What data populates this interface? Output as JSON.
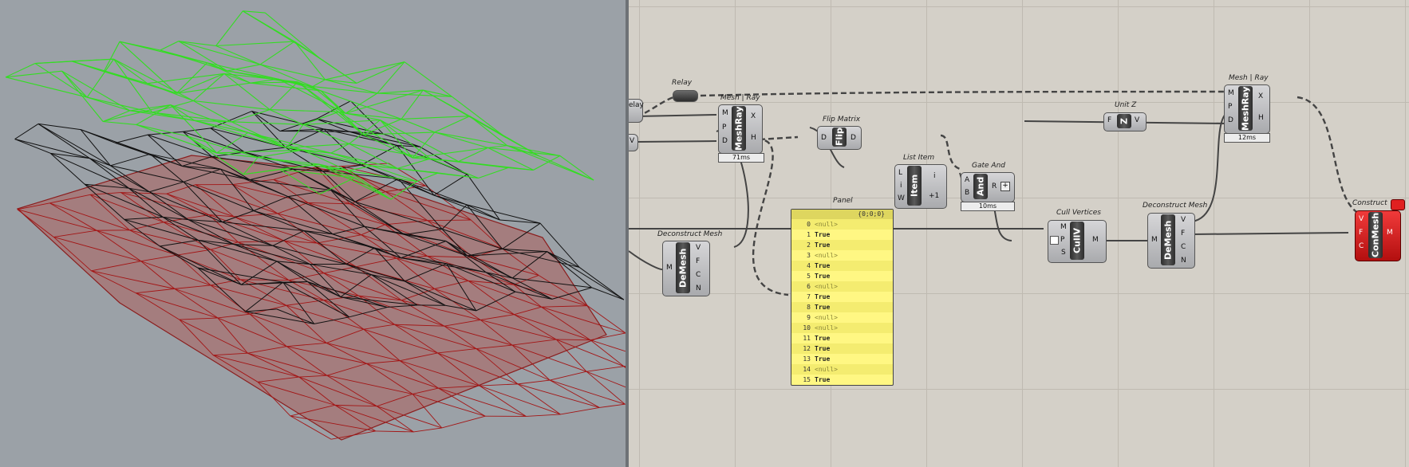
{
  "panel": {
    "title": "Panel",
    "path": "{0;0;0}",
    "rows": [
      {
        "index": "0",
        "value": "<null>"
      },
      {
        "index": "1",
        "value": "True"
      },
      {
        "index": "2",
        "value": "True"
      },
      {
        "index": "3",
        "value": "<null>"
      },
      {
        "index": "4",
        "value": "True"
      },
      {
        "index": "5",
        "value": "True"
      },
      {
        "index": "6",
        "value": "<null>"
      },
      {
        "index": "7",
        "value": "True"
      },
      {
        "index": "8",
        "value": "True"
      },
      {
        "index": "9",
        "value": "<null>"
      },
      {
        "index": "10",
        "value": "<null>"
      },
      {
        "index": "11",
        "value": "True"
      },
      {
        "index": "12",
        "value": "True"
      },
      {
        "index": "13",
        "value": "True"
      },
      {
        "index": "14",
        "value": "<null>"
      },
      {
        "index": "15",
        "value": "True"
      }
    ]
  },
  "components": {
    "relay": {
      "title": "Relay"
    },
    "relay_cut": {
      "label": "elay"
    },
    "meshray1": {
      "title": "Mesh | Ray",
      "core": "MeshRay",
      "inputs": [
        "M",
        "P",
        "D"
      ],
      "outputs": [
        "X",
        "H"
      ],
      "timer": "71ms"
    },
    "flip": {
      "title": "Flip Matrix",
      "core": "Flip",
      "input": "D",
      "output": "D"
    },
    "listitem": {
      "title": "List Item",
      "core": "Item",
      "inputs": [
        "L",
        "i",
        "W"
      ],
      "outputs": [
        "i",
        "+1"
      ]
    },
    "gateand": {
      "title": "Gate And",
      "core": "And",
      "inputs": [
        "A",
        "B"
      ],
      "output": "R",
      "timer": "10ms"
    },
    "demesh1": {
      "title": "Deconstruct Mesh",
      "core": "DeMesh",
      "input": "M",
      "outputs": [
        "V",
        "F",
        "C",
        "N"
      ]
    },
    "cullv": {
      "title": "Cull Vertices",
      "core": "CullV",
      "inputs": [
        "M",
        "P",
        "S"
      ],
      "output": "M"
    },
    "demesh2": {
      "title": "Deconstruct Mesh",
      "core": "DeMesh",
      "input": "M",
      "outputs": [
        "V",
        "F",
        "C",
        "N"
      ]
    },
    "unitz": {
      "title": "Unit Z",
      "core": "Z",
      "input": "F",
      "output": "V"
    },
    "meshray2": {
      "title": "Mesh | Ray",
      "core": "MeshRay",
      "inputs": [
        "M",
        "P",
        "D"
      ],
      "outputs": [
        "X",
        "H"
      ],
      "timer": "12ms"
    },
    "construct": {
      "title": "Construct",
      "core": "ConMesh",
      "inputs": [
        "V",
        "F",
        "C"
      ],
      "output": "M"
    }
  },
  "colors": {
    "canvas_bg": "#d4d0c8",
    "viewport_bg": "#9ba1a7",
    "mesh_green": "#33dd22",
    "mesh_black": "#111111",
    "mesh_red": "#a31515",
    "panel_yellow": "#fff783",
    "error_red": "#d91a1a"
  }
}
